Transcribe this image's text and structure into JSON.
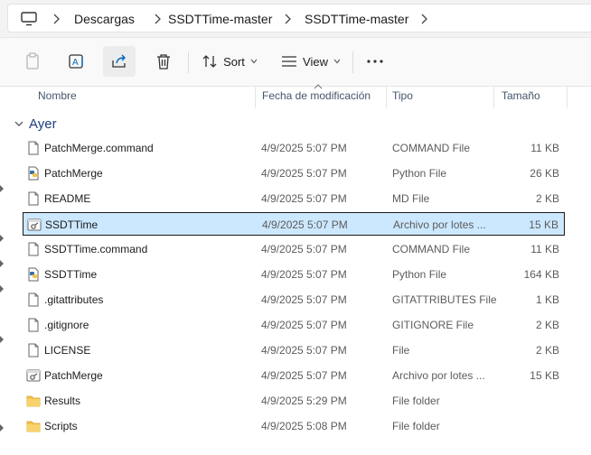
{
  "breadcrumb": {
    "items": [
      "Descargas",
      "SSDTTime-master",
      "SSDTTime-master"
    ]
  },
  "toolbar": {
    "sort_label": "Sort",
    "view_label": "View",
    "icons": [
      "paste-icon",
      "rename-icon",
      "share-icon",
      "delete-icon",
      "sort-icon",
      "view-icon",
      "more-icon"
    ]
  },
  "columns": {
    "name": "Nombre",
    "date": "Fecha de modificación",
    "type": "Tipo",
    "size": "Tamaño"
  },
  "group": {
    "title": "Ayer"
  },
  "files": [
    {
      "name": "PatchMerge.command",
      "date": "4/9/2025 5:07 PM",
      "type": "COMMAND File",
      "size": "11 KB",
      "icon": "blank-file-icon"
    },
    {
      "name": "PatchMerge",
      "date": "4/9/2025 5:07 PM",
      "type": "Python File",
      "size": "26 KB",
      "icon": "python-file-icon"
    },
    {
      "name": "README",
      "date": "4/9/2025 5:07 PM",
      "type": "MD File",
      "size": "2 KB",
      "icon": "blank-file-icon"
    },
    {
      "name": "SSDTTime",
      "date": "4/9/2025 5:07 PM",
      "type": "Archivo por lotes ...",
      "size": "15 KB",
      "icon": "batch-file-icon",
      "selected": true
    },
    {
      "name": "SSDTTime.command",
      "date": "4/9/2025 5:07 PM",
      "type": "COMMAND File",
      "size": "11 KB",
      "icon": "blank-file-icon"
    },
    {
      "name": "SSDTTime",
      "date": "4/9/2025 5:07 PM",
      "type": "Python File",
      "size": "164 KB",
      "icon": "python-file-icon"
    },
    {
      "name": ".gitattributes",
      "date": "4/9/2025 5:07 PM",
      "type": "GITATTRIBUTES File",
      "size": "1 KB",
      "icon": "blank-file-icon"
    },
    {
      "name": ".gitignore",
      "date": "4/9/2025 5:07 PM",
      "type": "GITIGNORE File",
      "size": "2 KB",
      "icon": "blank-file-icon"
    },
    {
      "name": "LICENSE",
      "date": "4/9/2025 5:07 PM",
      "type": "File",
      "size": "2 KB",
      "icon": "blank-file-icon"
    },
    {
      "name": "PatchMerge",
      "date": "4/9/2025 5:07 PM",
      "type": "Archivo por lotes ...",
      "size": "15 KB",
      "icon": "batch-file-icon"
    },
    {
      "name": "Results",
      "date": "4/9/2025 5:29 PM",
      "type": "File folder",
      "size": "",
      "icon": "folder-icon"
    },
    {
      "name": "Scripts",
      "date": "4/9/2025 5:08 PM",
      "type": "File folder",
      "size": "",
      "icon": "folder-icon"
    }
  ],
  "colors": {
    "selection_bg": "#cce8ff",
    "group_title": "#1e3e7a",
    "folder": "#f4c24d"
  }
}
